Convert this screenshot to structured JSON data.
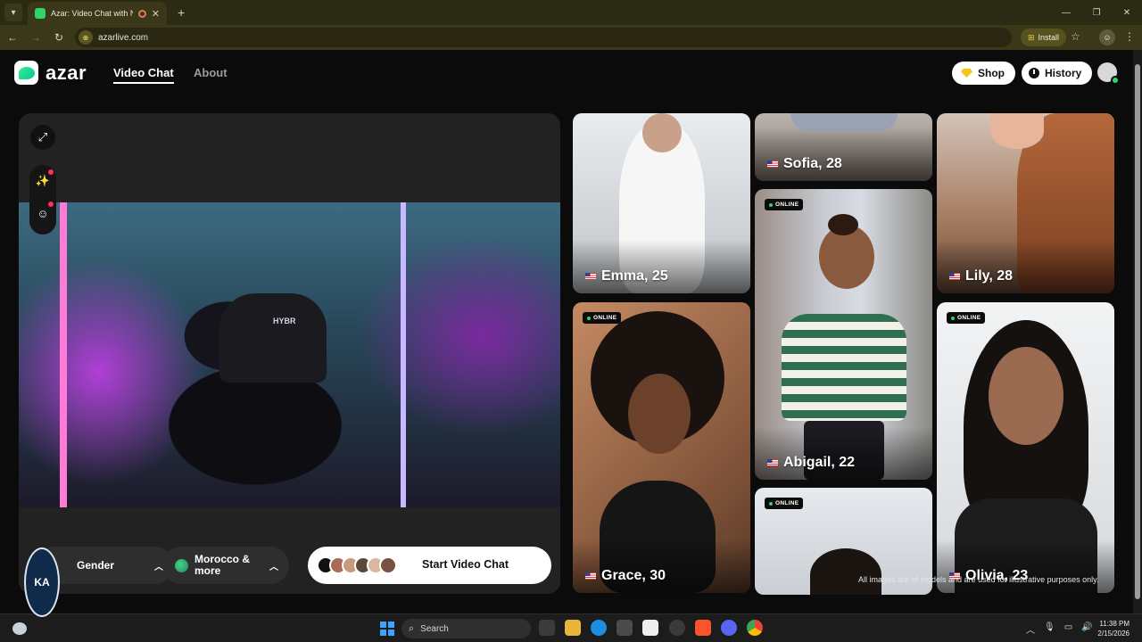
{
  "browser": {
    "tab_title": "Azar: Video Chat with New",
    "url": "azarlive.com",
    "install_label": "Install",
    "new_tab": "+"
  },
  "header": {
    "logo_text": "azar",
    "nav": {
      "video_chat": "Video Chat",
      "about": "About"
    },
    "shop_label": "Shop",
    "history_label": "History"
  },
  "video_panel": {
    "chair_logo": "HYBR",
    "gender_label": "Gender",
    "region_label": "Morocco & more",
    "start_label": "Start Video Chat"
  },
  "gallery": {
    "online_label": "ONLINE",
    "cards": [
      {
        "name": "Emma, 25",
        "online": false
      },
      {
        "name": "Sofia, 28",
        "online": false
      },
      {
        "name": "Lily, 28",
        "online": false
      },
      {
        "name": "Abigail, 22",
        "online": true
      },
      {
        "name": "Grace, 30",
        "online": true
      },
      {
        "name": "Olivia, 23",
        "online": true
      },
      {
        "name": "",
        "online": true
      }
    ],
    "disclaimer": "All images are of models and are used for illustrative purposes only."
  },
  "taskbar": {
    "search_placeholder": "Search",
    "time": "11:38 PM",
    "date": "2/15/2026"
  },
  "colors": {
    "accent_green": "#2fd56b",
    "browser_frame": "#3a3819",
    "page_bg": "#0b0b0b",
    "panel_bg": "#222222"
  }
}
